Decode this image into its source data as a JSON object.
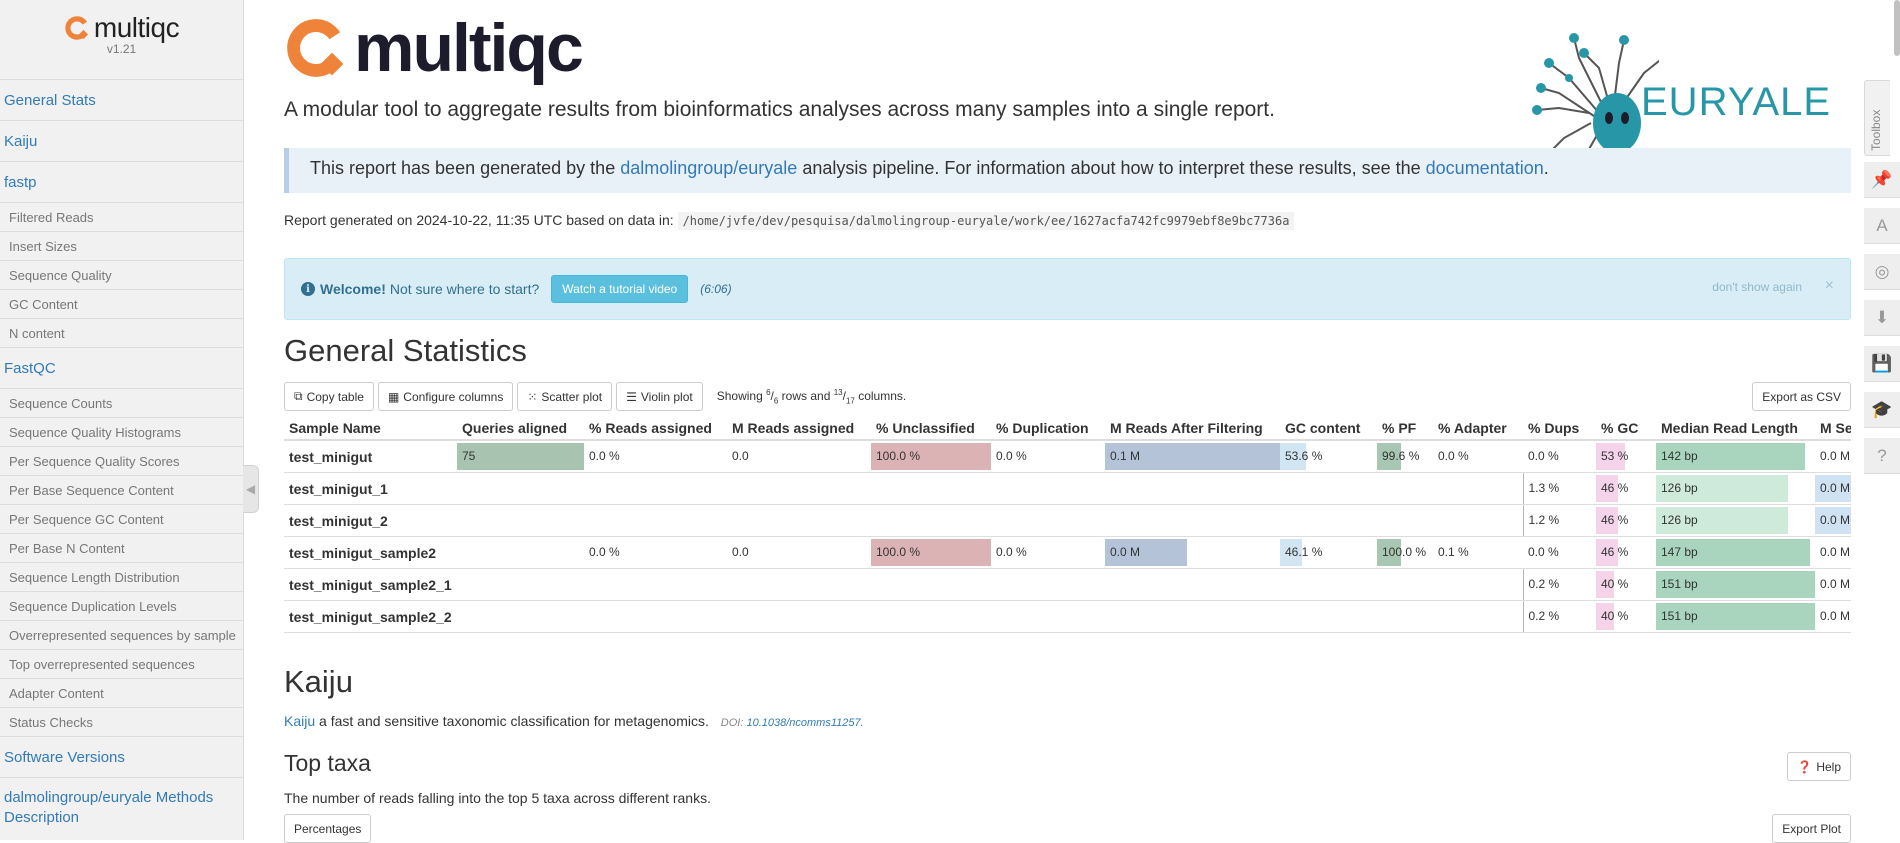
{
  "sidebar": {
    "logo_text": "multiqc",
    "version": "v1.21",
    "nav": [
      {
        "label": "General Stats",
        "level": 1
      },
      {
        "label": "Kaiju",
        "level": 1
      },
      {
        "label": "fastp",
        "level": 1
      },
      {
        "label": "Filtered Reads",
        "level": 2
      },
      {
        "label": "Insert Sizes",
        "level": 2
      },
      {
        "label": "Sequence Quality",
        "level": 2
      },
      {
        "label": "GC Content",
        "level": 2
      },
      {
        "label": "N content",
        "level": 2
      },
      {
        "label": "FastQC",
        "level": 1
      },
      {
        "label": "Sequence Counts",
        "level": 2
      },
      {
        "label": "Sequence Quality Histograms",
        "level": 2
      },
      {
        "label": "Per Sequence Quality Scores",
        "level": 2
      },
      {
        "label": "Per Base Sequence Content",
        "level": 2
      },
      {
        "label": "Per Sequence GC Content",
        "level": 2
      },
      {
        "label": "Per Base N Content",
        "level": 2
      },
      {
        "label": "Sequence Length Distribution",
        "level": 2
      },
      {
        "label": "Sequence Duplication Levels",
        "level": 2
      },
      {
        "label": "Overrepresented sequences by sample",
        "level": 2
      },
      {
        "label": "Top overrepresented sequences",
        "level": 2
      },
      {
        "label": "Adapter Content",
        "level": 2
      },
      {
        "label": "Status Checks",
        "level": 2
      },
      {
        "label": "Software Versions",
        "level": 1
      },
      {
        "label": "dalmolingroup/euryale Methods Description",
        "level": 1
      }
    ]
  },
  "header": {
    "logo_text": "multiqc",
    "subtitle": "A modular tool to aggregate results from bioinformatics analyses across many samples into a single report.",
    "euryale_text": "EURYALE"
  },
  "pipeline_box": {
    "prefix": "This report has been generated by the ",
    "pipeline_link": "dalmolingroup/euryale",
    "middle": " analysis pipeline. For information about how to interpret these results, see the ",
    "doc_link": "documentation",
    "suffix": "."
  },
  "report_info": {
    "prefix": "Report generated on 2024-10-22, 11:35 UTC based on data in:",
    "path": "/home/jvfe/dev/pesquisa/dalmolingroup-euryale/work/ee/1627acfa742fc9979ebf8e9bc7736a"
  },
  "welcome": {
    "bold": "Welcome!",
    "text": "Not sure where to start?",
    "button": "Watch a tutorial video",
    "duration": "(6:06)",
    "dont_show": "don't show again",
    "close": "×"
  },
  "general_stats": {
    "title": "General Statistics",
    "buttons": {
      "copy": "Copy table",
      "configure": "Configure columns",
      "scatter": "Scatter plot",
      "violin": "Violin plot",
      "export": "Export as CSV"
    },
    "showing": {
      "prefix": "Showing ",
      "rows_shown": "6",
      "rows_total": "6",
      "mid": " rows and ",
      "cols_shown": "13",
      "cols_total": "17",
      "suffix": " columns."
    },
    "columns": [
      "Sample Name",
      "Queries aligned",
      "% Reads assigned",
      "M Reads assigned",
      "% Unclassified",
      "% Duplication",
      "M Reads After Filtering",
      "GC content",
      "% PF",
      "% Adapter",
      "% Dups",
      "% GC",
      "Median Read Length",
      "M Seqs"
    ],
    "rows": [
      {
        "name": "test_minigut",
        "queries": "75",
        "pct_assigned": "0.0 %",
        "m_assigned": "0.0",
        "pct_unclassified": "100.0 %",
        "pct_dup": "0.0 %",
        "m_after": "0.1 M",
        "gc": "53.6 %",
        "pct_pf": "99.6 %",
        "pct_adapter": "0.0 %",
        "pct_dups": "0.0 %",
        "pct_gc": "53 %",
        "median_len": "142 bp",
        "m_seqs": "0.0 M"
      },
      {
        "name": "test_minigut_1",
        "queries": "",
        "pct_assigned": "",
        "m_assigned": "",
        "pct_unclassified": "",
        "pct_dup": "",
        "m_after": "",
        "gc": "",
        "pct_pf": "",
        "pct_adapter": "",
        "pct_dups": "1.3 %",
        "pct_gc": "46 %",
        "median_len": "126 bp",
        "m_seqs": "0.0 M"
      },
      {
        "name": "test_minigut_2",
        "queries": "",
        "pct_assigned": "",
        "m_assigned": "",
        "pct_unclassified": "",
        "pct_dup": "",
        "m_after": "",
        "gc": "",
        "pct_pf": "",
        "pct_adapter": "",
        "pct_dups": "1.2 %",
        "pct_gc": "46 %",
        "median_len": "126 bp",
        "m_seqs": "0.0 M"
      },
      {
        "name": "test_minigut_sample2",
        "queries": "",
        "pct_assigned": "0.0 %",
        "m_assigned": "0.0",
        "pct_unclassified": "100.0 %",
        "pct_dup": "0.0 %",
        "m_after": "0.0 M",
        "gc": "46.1 %",
        "pct_pf": "100.0 %",
        "pct_adapter": "0.1 %",
        "pct_dups": "0.0 %",
        "pct_gc": "46 %",
        "median_len": "147 bp",
        "m_seqs": "0.0 M"
      },
      {
        "name": "test_minigut_sample2_1",
        "queries": "",
        "pct_assigned": "",
        "m_assigned": "",
        "pct_unclassified": "",
        "pct_dup": "",
        "m_after": "",
        "gc": "",
        "pct_pf": "",
        "pct_adapter": "",
        "pct_dups": "0.2 %",
        "pct_gc": "40 %",
        "median_len": "151 bp",
        "m_seqs": "0.0 M"
      },
      {
        "name": "test_minigut_sample2_2",
        "queries": "",
        "pct_assigned": "",
        "m_assigned": "",
        "pct_unclassified": "",
        "pct_dup": "",
        "m_after": "",
        "gc": "",
        "pct_pf": "",
        "pct_adapter": "",
        "pct_dups": "0.2 %",
        "pct_gc": "40 %",
        "median_len": "151 bp",
        "m_seqs": "0.0 M"
      }
    ],
    "bar_levels": [
      {
        "queries": 1.0,
        "pct_unclassified": 1.0,
        "m_after": 1.0,
        "gc": 0.27,
        "pct_pf": 0.43,
        "pct_gc": 0.48,
        "median_len": 0.94
      },
      {
        "pct_gc": 0.37,
        "median_len": 0.83
      },
      {
        "pct_gc": 0.37,
        "median_len": 0.83
      },
      {
        "pct_unclassified": 1.0,
        "m_after": 0.47,
        "gc": 0.23,
        "pct_pf": 0.43,
        "pct_gc": 0.37,
        "median_len": 0.97
      },
      {
        "pct_gc": 0.3,
        "median_len": 1.0
      },
      {
        "pct_gc": 0.3,
        "median_len": 1.0
      }
    ],
    "bar_colors": {
      "queries": "#a8c3b0",
      "pct_unclassified": "#dcb3b5",
      "m_after": "#b5c3d8",
      "gc": "#d2e5f3",
      "pct_pf": "#a8c7b3",
      "pct_gc": "#f5d3e8",
      "median_len_strong": "#a9d5be",
      "median_len_light": "#cdeadb",
      "m_seqs": "#cfe2f3"
    }
  },
  "kaiju": {
    "title": "Kaiju",
    "link": "Kaiju",
    "desc": " a fast and sensitive taxonomic classification for metagenomics.",
    "doi_prefix": "DOI: ",
    "doi": "10.1038/ncomms11257.",
    "subtitle": "Top taxa",
    "help": "Help",
    "subdesc": "The number of reads falling into the top 5 taxa across different ranks.",
    "pct_button": "Percentages",
    "export_plot": "Export Plot"
  },
  "toolbox": {
    "label": "Toolbox",
    "icons": [
      "pin-icon",
      "font-icon",
      "eye-slash-icon",
      "download-icon",
      "save-icon",
      "graduation-cap-icon",
      "help-icon"
    ]
  },
  "colors": {
    "link": "#337ab7",
    "logo_orange": "#f0833a",
    "logo_dark": "#1c1c2c",
    "euryale_teal": "#2797a8",
    "info_bg": "#d9edf7"
  }
}
